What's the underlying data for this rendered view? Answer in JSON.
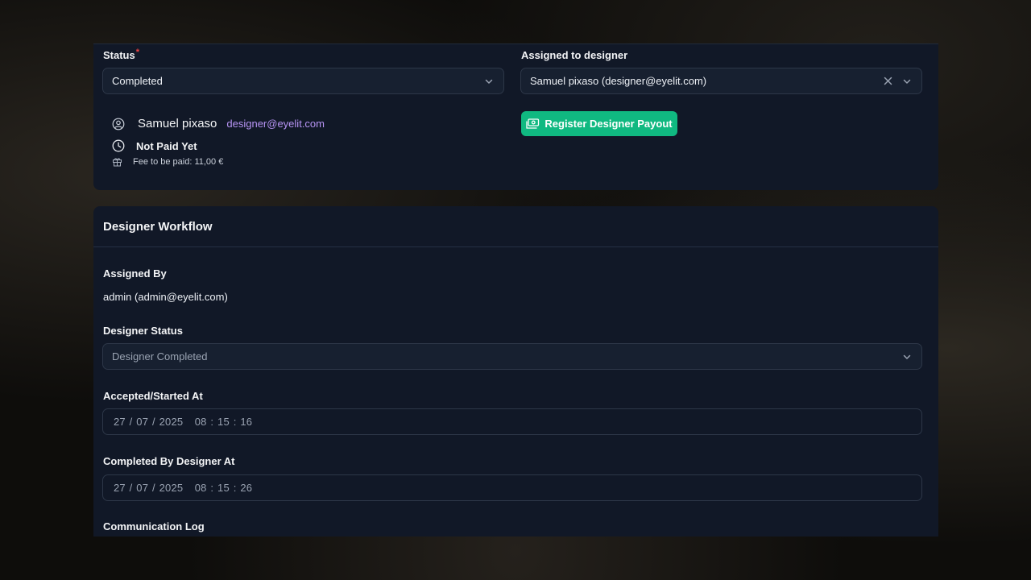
{
  "order": {
    "status_label": "Status",
    "status_required_mark": "*",
    "status_value": "Completed",
    "assigned_label": "Assigned to designer",
    "assigned_value": "Samuel pixaso (designer@eyelit.com)",
    "designer_name": "Samuel pixaso",
    "designer_email": "designer@eyelit.com",
    "payment_status": "Not Paid Yet",
    "fee_text": "Fee to be paid: 11,00 €",
    "payout_button": "Register Designer Payout"
  },
  "workflow": {
    "title": "Designer Workflow",
    "assigned_by_label": "Assigned By",
    "assigned_by_value": "admin (admin@eyelit.com)",
    "designer_status_label": "Designer Status",
    "designer_status_value": "Designer Completed",
    "accepted_label": "Accepted/Started At",
    "accepted_value": "27 / 07 / 2025   08 : 15 : 16",
    "completed_label": "Completed By Designer At",
    "completed_value": "27 / 07 / 2025   08 : 15 : 26",
    "communication_label": "Communication Log"
  },
  "colors": {
    "panel": "#111827",
    "accent_green": "#10b981",
    "email_purple": "#b794f4",
    "required_red": "#ef4444"
  },
  "icons": [
    "chevron-down-icon",
    "close-icon",
    "user-circle-icon",
    "clock-icon",
    "gift-icon",
    "money-icon"
  ]
}
